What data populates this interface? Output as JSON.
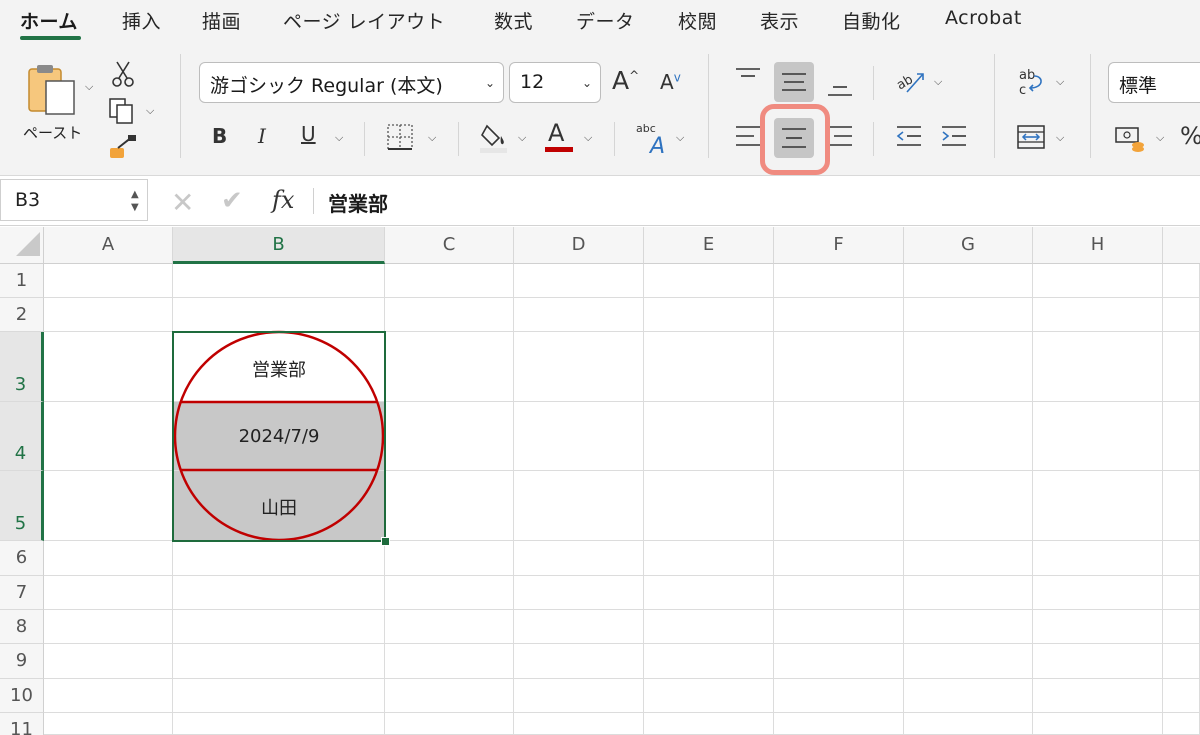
{
  "tabs": [
    "ホーム",
    "挿入",
    "描画",
    "ページ レイアウト",
    "数式",
    "データ",
    "校閲",
    "表示",
    "自動化",
    "Acrobat"
  ],
  "ribbon": {
    "paste_label": "ペースト",
    "font_name": "游ゴシック Regular (本文)",
    "font_size": "12",
    "grow_font": "A",
    "shrink_font": "A",
    "bold": "B",
    "italic": "I",
    "underline": "U",
    "font_color_glyph": "A",
    "font_color": "#c00000",
    "number_format": "標準",
    "percent": "%",
    "highlight_color": "#f08b80",
    "selected_button_color": "#c6c6c6"
  },
  "formula_bar": {
    "name_box": "B3",
    "fx": "fx",
    "value": "営業部"
  },
  "columns": [
    "A",
    "B",
    "C",
    "D",
    "E",
    "F",
    "G",
    "H"
  ],
  "selected_column": "B",
  "rows": [
    "1",
    "2",
    "3",
    "4",
    "5",
    "6",
    "7",
    "8",
    "9",
    "10",
    "11"
  ],
  "selected_rows": [
    "3",
    "4",
    "5"
  ],
  "cells": {
    "B3": "営業部",
    "B4": "2024/7/9",
    "B5": "山田"
  },
  "stamp_color": "#c00000",
  "accent_color": "#217346"
}
